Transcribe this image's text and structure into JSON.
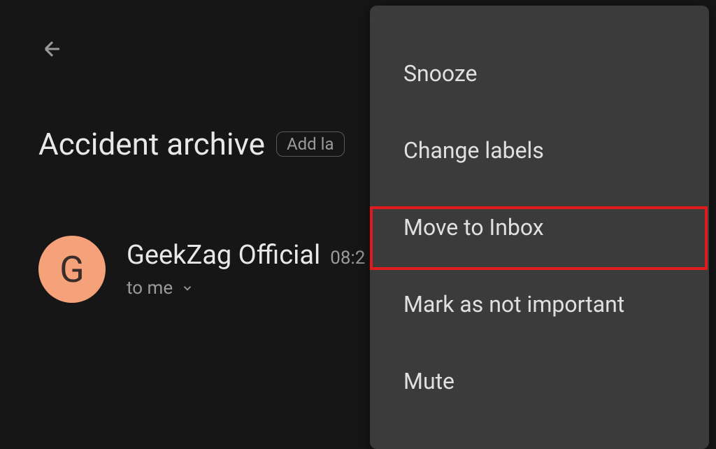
{
  "header": {
    "subject": "Accident archive",
    "label_chip": "Add la"
  },
  "sender": {
    "avatar_letter": "G",
    "name": "GeekZag Official",
    "time": "08:2",
    "recipient": "to me"
  },
  "menu": {
    "items": [
      "Snooze",
      "Change labels",
      "Move to Inbox",
      "Mark as not important",
      "Mute"
    ]
  }
}
